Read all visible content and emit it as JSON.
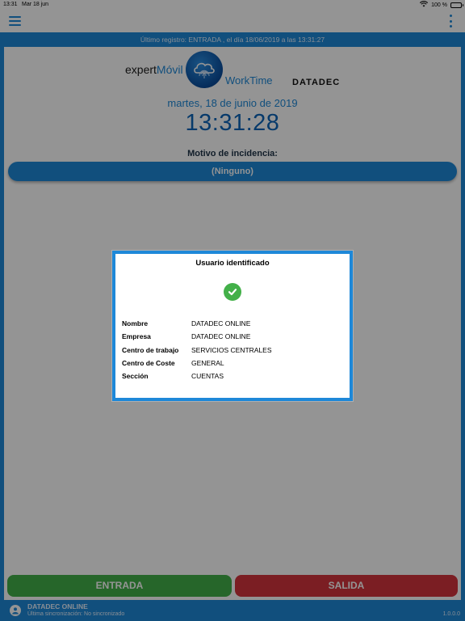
{
  "status_bar": {
    "time": "13:31",
    "date": "Mar 18 jun",
    "battery": "100 %"
  },
  "header": {
    "last_record": "Último registro:  ENTRADA , el día 18/06/2019 a las 13:31:27"
  },
  "logo": {
    "expert": "expert",
    "movil": "Móvil",
    "worktime": "WorkTime",
    "datadec": "DATADEC"
  },
  "clock": {
    "date": "martes, 18 de junio de 2019",
    "time": "13:31:28"
  },
  "incidence": {
    "label": "Motivo de incidencia:",
    "selected": "(Ninguno)"
  },
  "actions": {
    "entrada": "ENTRADA",
    "salida": "SALIDA"
  },
  "footer": {
    "user": "DATADEC ONLINE",
    "sync": "Última sincronización: No sincronizado",
    "version": "1.0.0.0"
  },
  "dialog": {
    "title": "Usuario identificado",
    "rows": [
      {
        "label": "Nombre",
        "value": "DATADEC ONLINE"
      },
      {
        "label": "Empresa",
        "value": "DATADEC ONLINE"
      },
      {
        "label": "Centro de trabajo",
        "value": "SERVICIOS CENTRALES"
      },
      {
        "label": "Centro de Coste",
        "value": "GENERAL"
      },
      {
        "label": "Sección",
        "value": "CUENTAS"
      }
    ]
  },
  "colors": {
    "accent": "#1e88d8",
    "success": "#43b049",
    "danger": "#d5343d"
  }
}
